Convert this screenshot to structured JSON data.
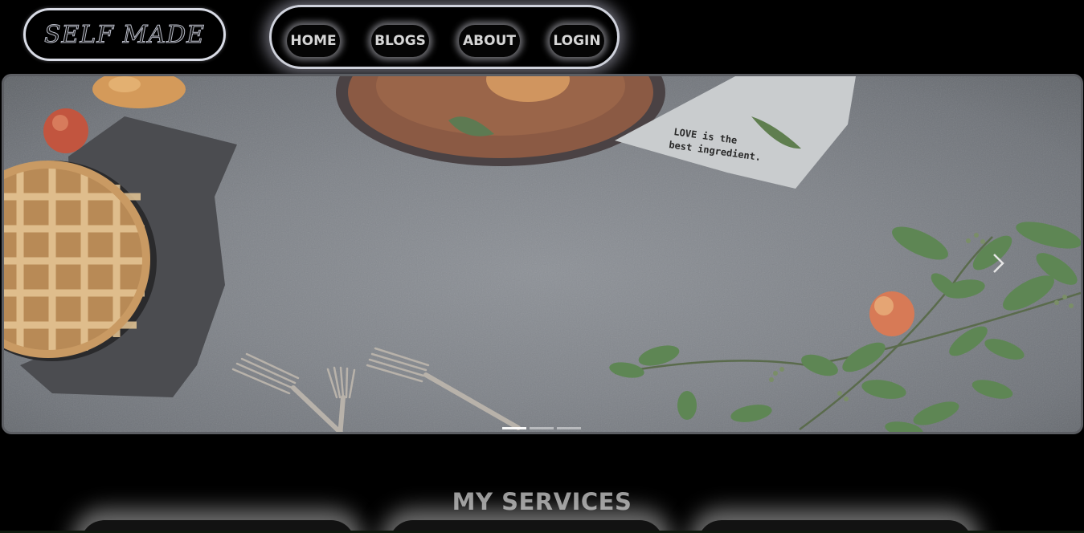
{
  "header": {
    "logo_text": "SELF MADE",
    "nav": [
      {
        "label": "HOME"
      },
      {
        "label": "BLOGS"
      },
      {
        "label": "ABOUT"
      },
      {
        "label": "LOGIN"
      }
    ]
  },
  "hero": {
    "napkin_text_line1": "LOVE is the",
    "napkin_text_line2": "best ingredient.",
    "next_icon": "chevron-right-icon",
    "indicator_count": 3,
    "active_indicator": 1
  },
  "services": {
    "title": "MY SERVICES"
  }
}
